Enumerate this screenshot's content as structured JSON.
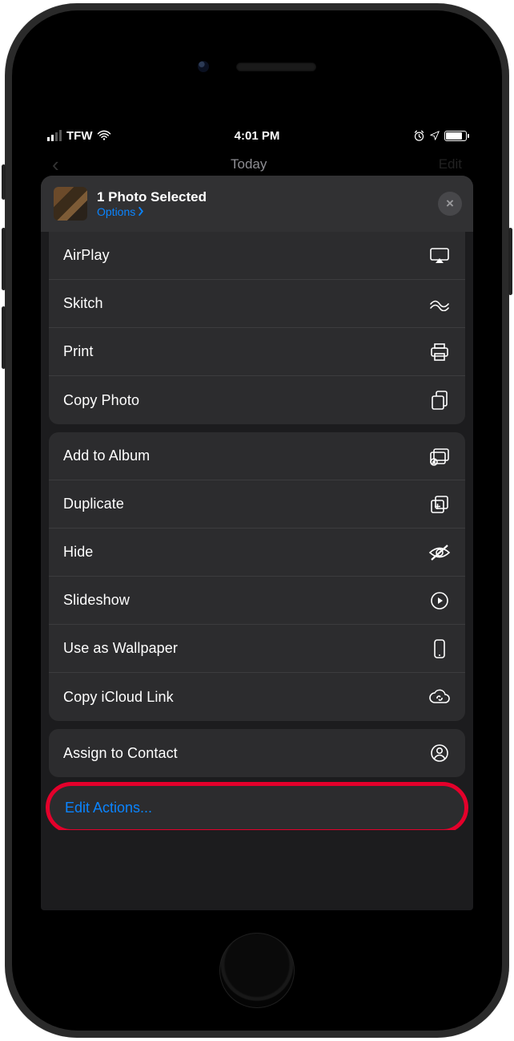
{
  "statusbar": {
    "carrier": "TFW",
    "time": "4:01 PM"
  },
  "nav": {
    "title": "Today",
    "edit": "Edit"
  },
  "sheet": {
    "title": "1 Photo Selected",
    "options": "Options",
    "close": "×"
  },
  "group1": [
    {
      "label": "AirPlay",
      "icon": "airplay-icon"
    },
    {
      "label": "Skitch",
      "icon": "skitch-icon"
    },
    {
      "label": "Print",
      "icon": "print-icon"
    },
    {
      "label": "Copy Photo",
      "icon": "copy-photo-icon"
    }
  ],
  "group2": [
    {
      "label": "Add to Album",
      "icon": "album-add-icon"
    },
    {
      "label": "Duplicate",
      "icon": "duplicate-icon"
    },
    {
      "label": "Hide",
      "icon": "hide-icon"
    },
    {
      "label": "Slideshow",
      "icon": "play-circle-icon"
    },
    {
      "label": "Use as Wallpaper",
      "icon": "phone-icon"
    },
    {
      "label": "Copy iCloud Link",
      "icon": "cloud-link-icon"
    }
  ],
  "group3": [
    {
      "label": "Assign to Contact",
      "icon": "contact-icon"
    }
  ],
  "editActions": "Edit Actions..."
}
